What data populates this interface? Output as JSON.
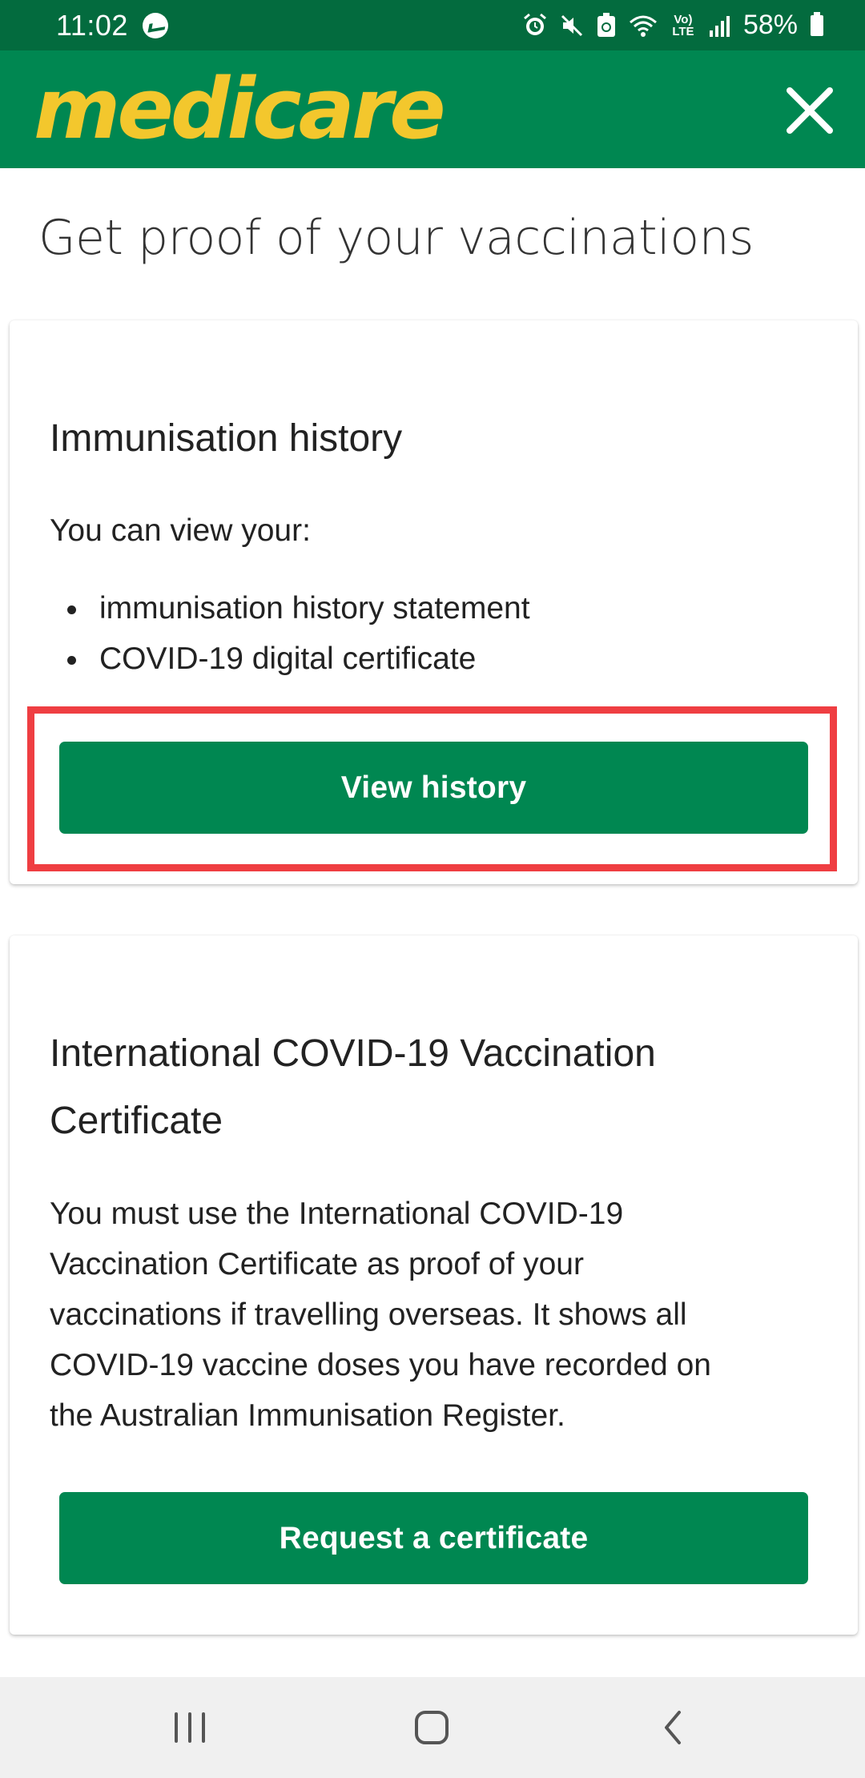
{
  "status_bar": {
    "time": "11:02",
    "battery": "58%",
    "network": "Vo) LTE",
    "icons": [
      "messenger-icon",
      "alarm-icon",
      "mute-icon",
      "recycle-icon",
      "wifi-icon",
      "lte-icon",
      "signal-icon",
      "battery-icon"
    ]
  },
  "app_bar": {
    "logo": "medicare",
    "logo_color": "#f3c72d",
    "background_color": "#008751",
    "close_icon": "close-icon"
  },
  "page": {
    "title": "Get proof of your vaccinations"
  },
  "cards": {
    "immunisation": {
      "heading": "Immunisation history",
      "intro": "You can view your:",
      "bullets": [
        "immunisation history statement",
        "COVID-19 digital certificate"
      ],
      "button_label": "View history"
    },
    "international": {
      "heading_line1": "International COVID-19 Vaccination",
      "heading_line2": "Certificate",
      "body_lines": [
        "You must use the International COVID-19",
        "Vaccination Certificate as proof of your",
        "vaccinations if travelling overseas. It shows all",
        "COVID-19 vaccine doses you have recorded on",
        "the Australian Immunisation Register."
      ],
      "button_label": "Request a certificate"
    }
  },
  "highlight_color": "#ef3e42",
  "nav_bar": {
    "buttons": [
      "recent-apps-icon",
      "home-icon",
      "back-icon"
    ]
  }
}
